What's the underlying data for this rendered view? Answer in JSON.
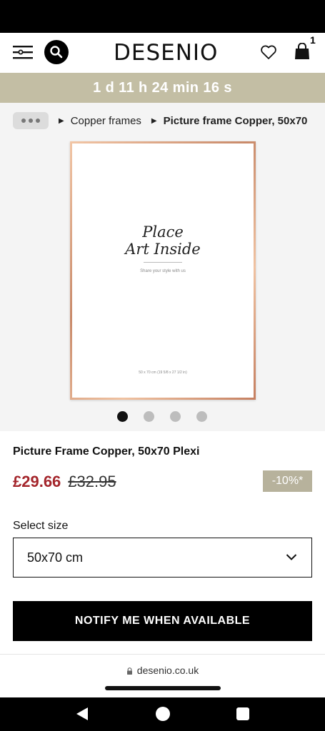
{
  "header": {
    "logo": "DESENIO",
    "cart_count": "1"
  },
  "countdown": "1 d 11 h 24 min 16 s",
  "breadcrumb": {
    "items": [
      "Copper frames",
      "Picture frame Copper, 50x70"
    ]
  },
  "gallery": {
    "poster_line1": "Place",
    "poster_line2": "Art Inside",
    "poster_subtitle": "Share your style with us",
    "poster_dimensions": "50 x 70 cm  (19 5/8 x 27 1/2 in)",
    "slide_count": 4,
    "active_slide": 1
  },
  "product": {
    "title": "Picture Frame Copper, 50x70 Plexi",
    "price": "£29.66",
    "old_price": "£32.95",
    "discount": "-10%*"
  },
  "size": {
    "label": "Select size",
    "selected": "50x70 cm"
  },
  "notify_button": "NOTIFY ME WHEN AVAILABLE",
  "browser": {
    "url": "desenio.co.uk"
  },
  "colors": {
    "countdown_bg": "#c3bea4",
    "price": "#a4262c",
    "badge_bg": "#b7b29c",
    "frame": "#d39a78"
  }
}
